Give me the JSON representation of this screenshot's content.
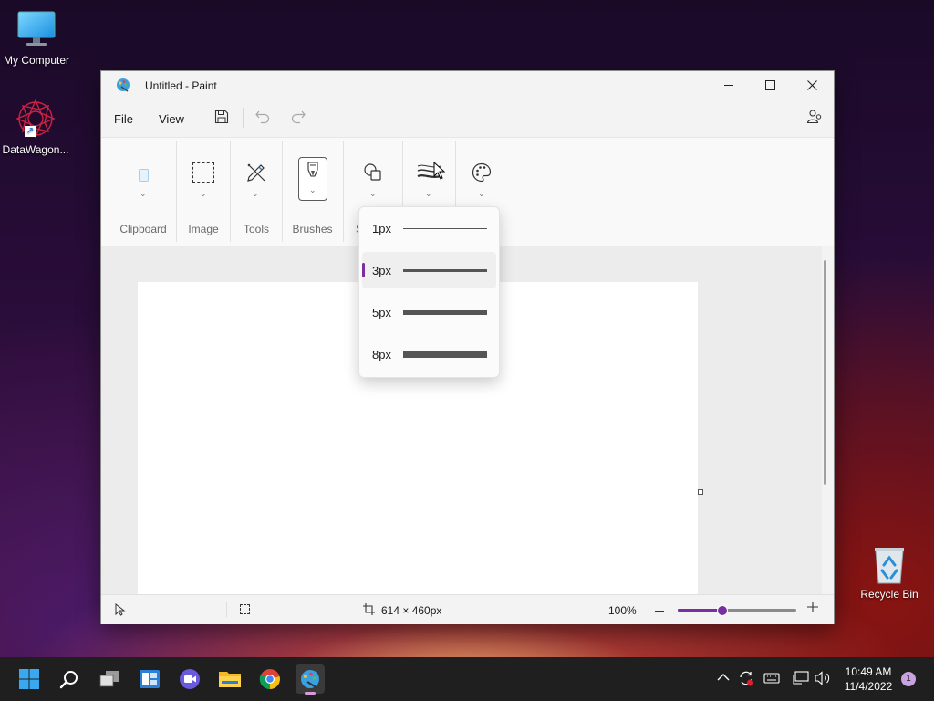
{
  "desktop": {
    "icons": [
      {
        "label": "My Computer"
      },
      {
        "label": "DataWagon..."
      },
      {
        "label": "Recycle Bin"
      }
    ]
  },
  "window": {
    "title": "Untitled - Paint",
    "menu": {
      "file": "File",
      "view": "View"
    },
    "ribbon": {
      "clipboard": "Clipboard",
      "image": "Image",
      "tools": "Tools",
      "brushes": "Brushes",
      "shapes": "S"
    },
    "size_dropdown": {
      "items": [
        {
          "label": "1px",
          "selected": false
        },
        {
          "label": "3px",
          "selected": true
        },
        {
          "label": "5px",
          "selected": false
        },
        {
          "label": "8px",
          "selected": false
        }
      ]
    },
    "status": {
      "canvas_size": "614 × 460px",
      "zoom": "100%",
      "zoom_slider_fraction": 0.38
    }
  },
  "taskbar": {
    "clock_time": "10:49 AM",
    "clock_date": "11/4/2022",
    "notification_count": "1"
  },
  "colors": {
    "accent": "#7a2fa0",
    "taskbar": "#1f1f1f"
  }
}
